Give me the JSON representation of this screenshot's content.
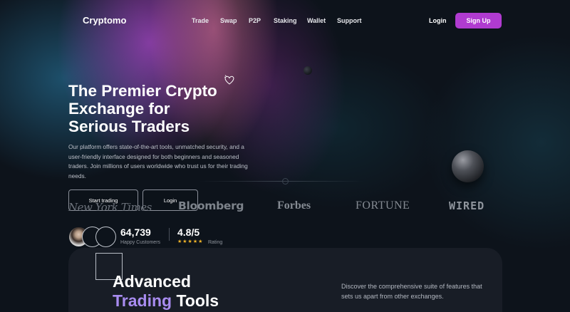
{
  "brand": {
    "name": "Cryptomo"
  },
  "nav": {
    "items": [
      {
        "label": "Trade"
      },
      {
        "label": "Swap"
      },
      {
        "label": "P2P"
      },
      {
        "label": "Staking"
      },
      {
        "label": "Wallet"
      },
      {
        "label": "Support"
      }
    ],
    "login_label": "Login",
    "signup_label": "Sign Up"
  },
  "hero": {
    "title_lines": [
      "The Premier Crypto",
      "Exchange for",
      "Serious Traders"
    ],
    "description": "Our platform offers state-of-the-art tools, unmatched security, and a user-friendly interface designed for both beginners and seasoned traders. Join millions of users worldwide who trust us for their trading needs.",
    "primary_cta": "Start trading",
    "secondary_cta": "Login"
  },
  "press_logos": [
    {
      "name": "New York Times",
      "text": "New York Times"
    },
    {
      "name": "Bloomberg",
      "text": "Bloomberg"
    },
    {
      "name": "Forbes",
      "text": "Forbes"
    },
    {
      "name": "Fortune",
      "text": "FORTUNE"
    },
    {
      "name": "Wired",
      "text": "WIRED"
    }
  ],
  "stats": {
    "customers": {
      "value": "64,739",
      "label": "Happy Customers"
    },
    "rating": {
      "value": "4.8/5",
      "label": "Rating",
      "stars": "★★★★★"
    }
  },
  "features": {
    "title_line1": "Advanced",
    "title_accent": "Trading",
    "title_rest": "Tools",
    "description": "Discover the comprehensive suite of features that sets us apart from other exchanges."
  },
  "colors": {
    "background": "#0d131b",
    "accent": "#b03bd0",
    "heading_accent": "#a88cf0",
    "star": "#f0b429",
    "card": "#181d26"
  },
  "icons": [
    "heart-doodle-icon",
    "star-icon"
  ]
}
